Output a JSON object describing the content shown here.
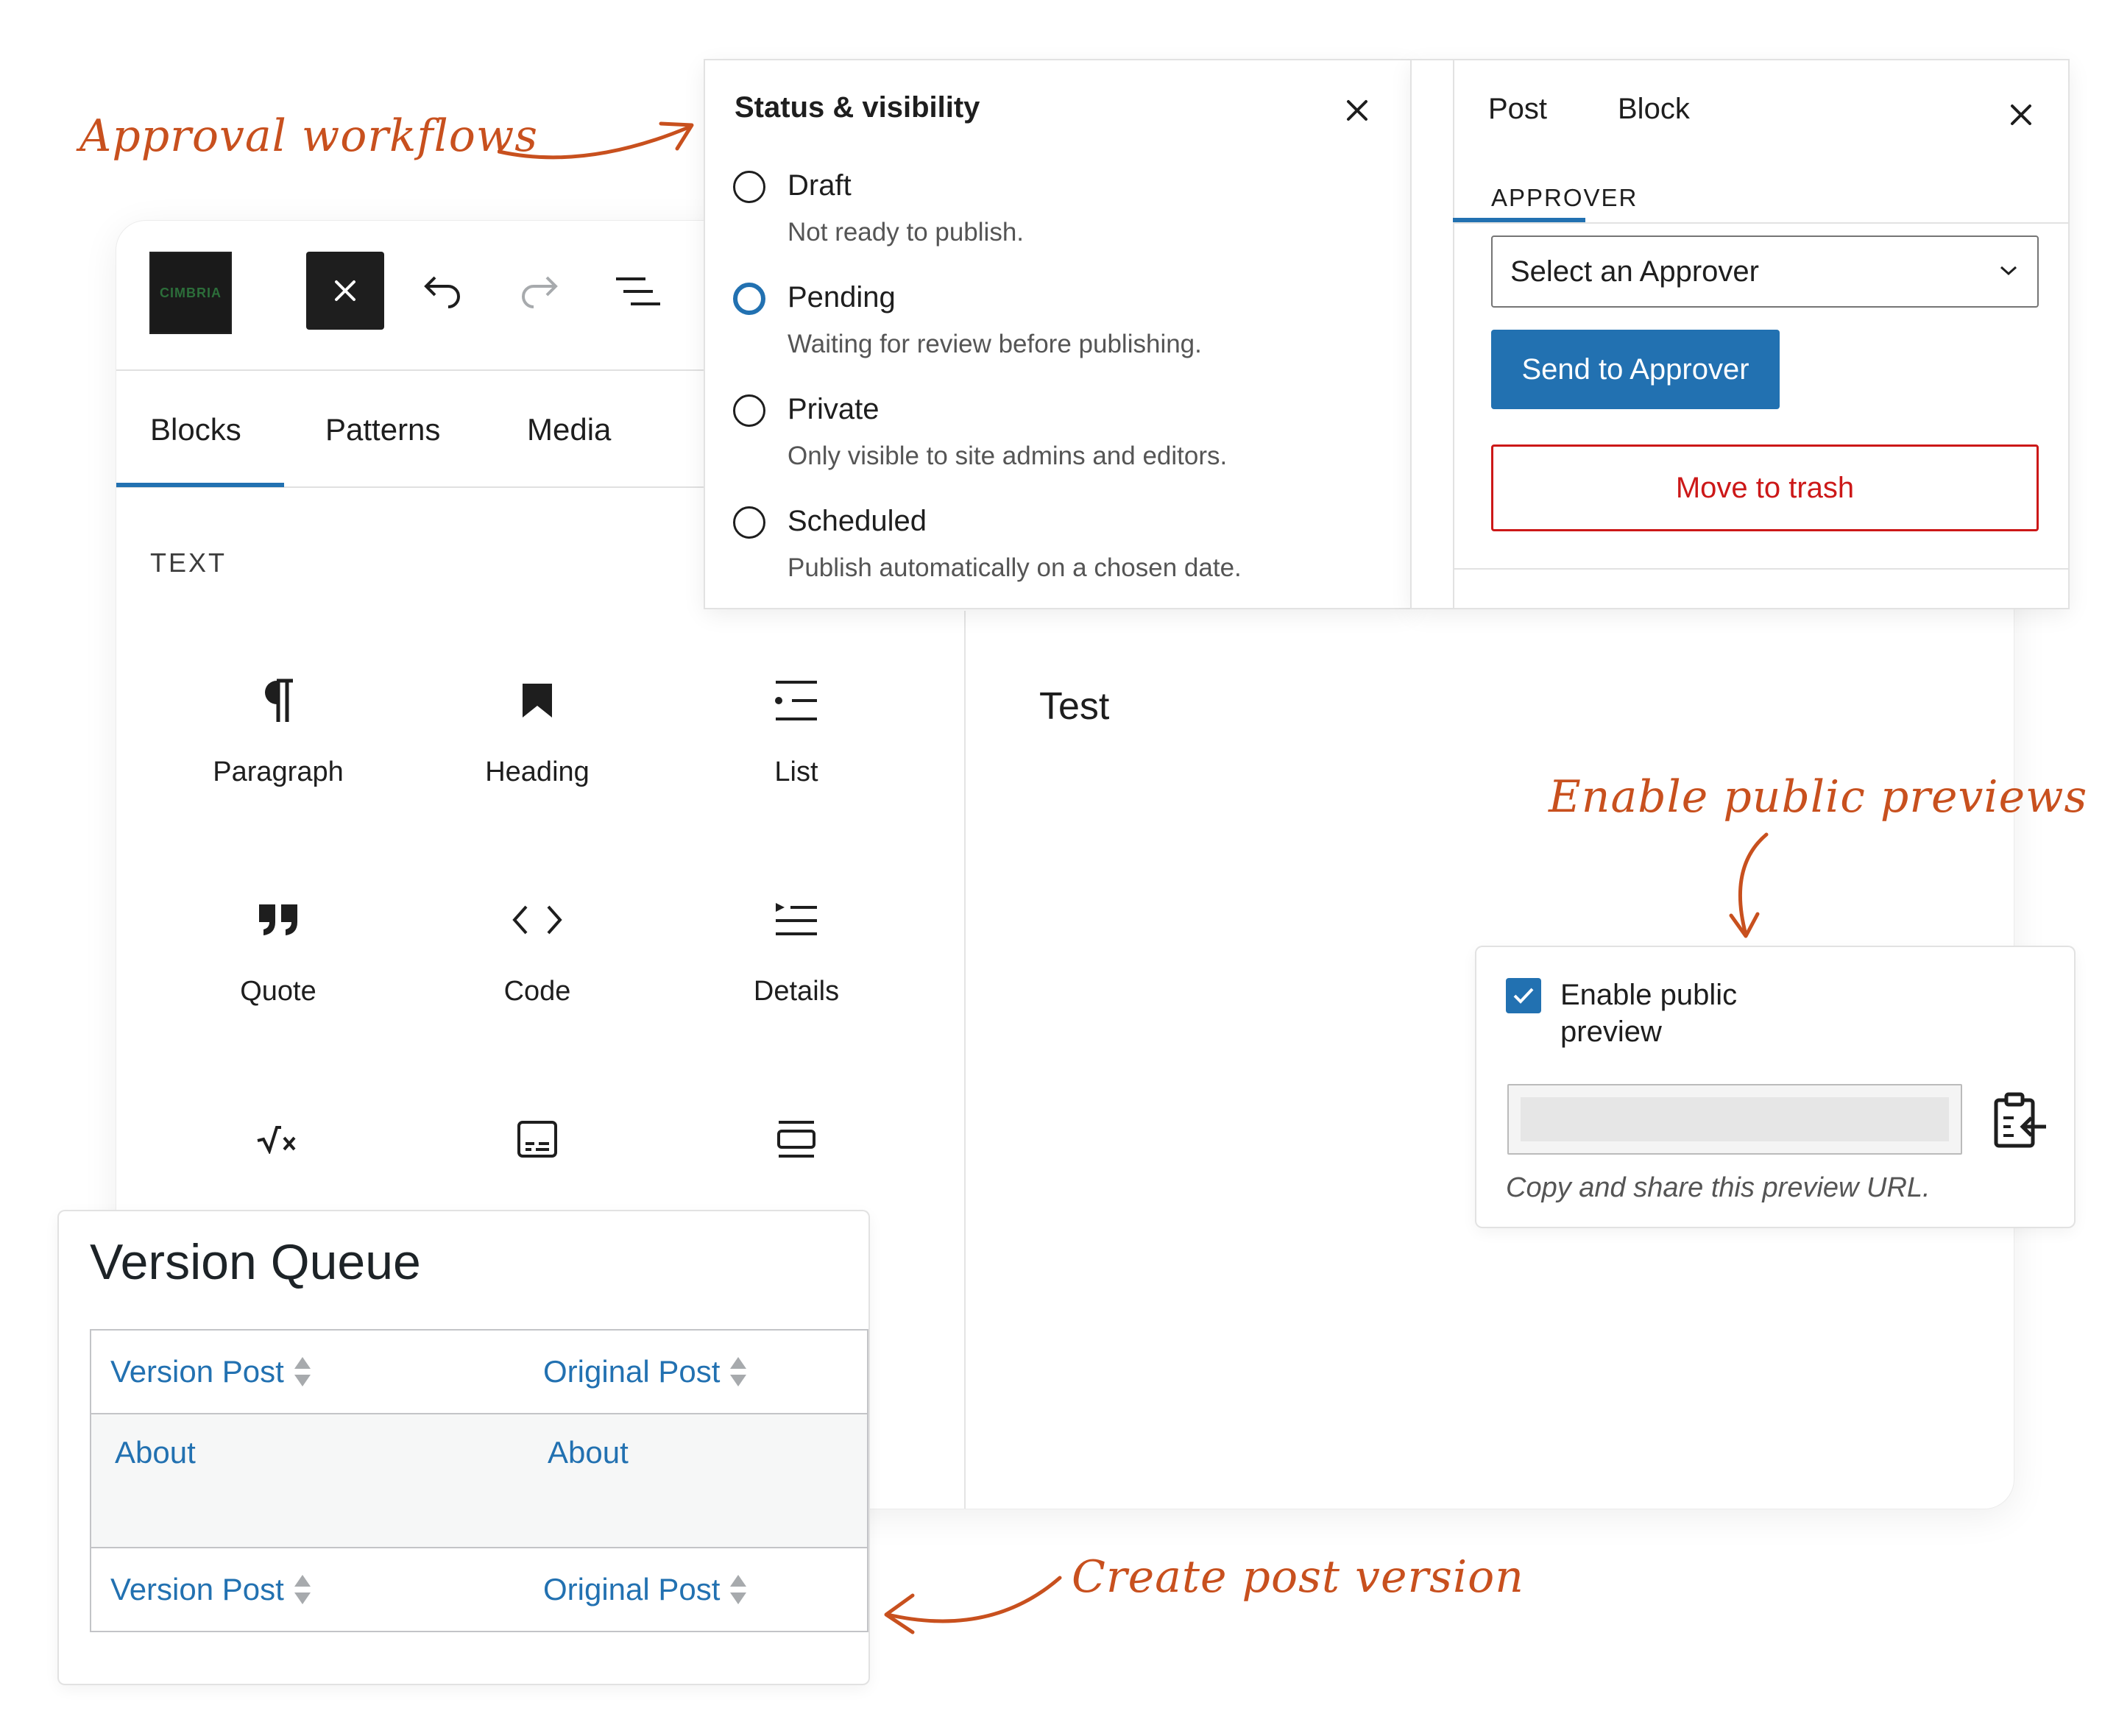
{
  "annotations": {
    "approval": "Approval workflows",
    "previews": "Enable public previews",
    "version": "Create post version"
  },
  "colors": {
    "accent": "#2271b1",
    "danger": "#cc1818",
    "annotation": "#c8501e"
  },
  "toolbar": {
    "logo_text": "CIMBRIA",
    "close_icon": "close-icon",
    "undo_icon": "undo-icon",
    "redo_icon": "redo-icon",
    "document_overview_icon": "list-view-icon"
  },
  "inserter": {
    "tabs": [
      "Blocks",
      "Patterns",
      "Media"
    ],
    "active_tab": "Blocks",
    "section": "TEXT",
    "blocks": [
      {
        "label": "Paragraph",
        "icon": "paragraph-icon"
      },
      {
        "label": "Heading",
        "icon": "heading-icon"
      },
      {
        "label": "List",
        "icon": "list-icon"
      },
      {
        "label": "Quote",
        "icon": "quote-icon"
      },
      {
        "label": "Code",
        "icon": "code-icon"
      },
      {
        "label": "Details",
        "icon": "details-icon"
      },
      {
        "label": "",
        "icon": "math-icon"
      },
      {
        "label": "",
        "icon": "preformatted-icon"
      },
      {
        "label": "",
        "icon": "verse-icon"
      }
    ]
  },
  "status": {
    "title": "Status & visibility",
    "options": [
      {
        "label": "Draft",
        "desc": "Not ready to publish.",
        "selected": false
      },
      {
        "label": "Pending",
        "desc": "Waiting for review before publishing.",
        "selected": true
      },
      {
        "label": "Private",
        "desc": "Only visible to site admins and editors.",
        "selected": false
      },
      {
        "label": "Scheduled",
        "desc": "Publish automatically on a chosen date.",
        "selected": false
      }
    ]
  },
  "sidebar": {
    "tabs": [
      "Post",
      "Block"
    ],
    "active_tab": "Post",
    "approver_label": "APPROVER",
    "select_value": "Select an Approver",
    "send_label": "Send to Approver",
    "trash_label": "Move to trash"
  },
  "content": {
    "text": "Test"
  },
  "preview": {
    "checkbox_label": "Enable public preview",
    "checked": true,
    "url_value": "",
    "help": "Copy and share this preview URL."
  },
  "version_queue": {
    "title": "Version Queue",
    "columns": [
      "Version Post",
      "Original Post"
    ],
    "rows": [
      [
        "About",
        "About"
      ]
    ]
  }
}
